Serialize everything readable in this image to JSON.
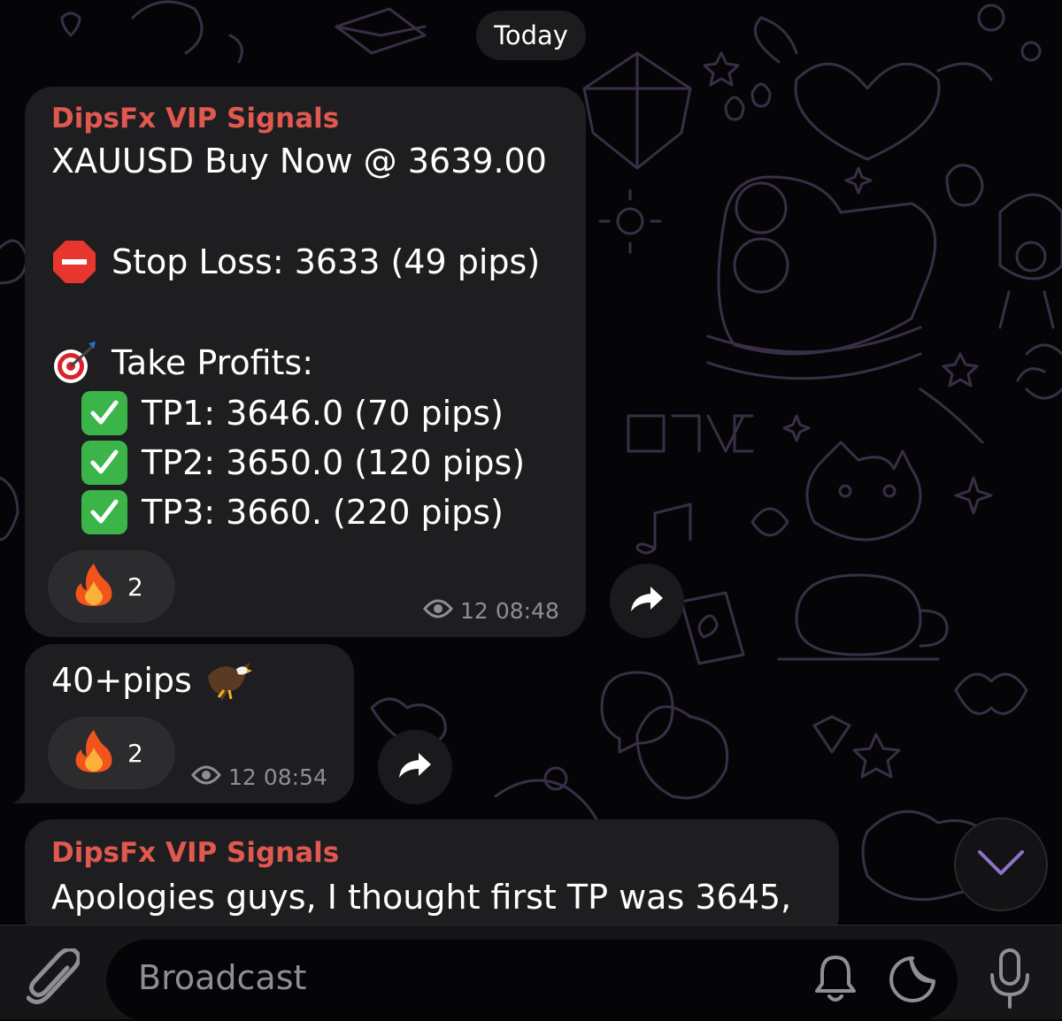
{
  "date_separator": "Today",
  "messages": [
    {
      "sender": "DipsFx VIP Signals",
      "headline": "XAUUSD Buy Now @ 3639.00",
      "stop_loss": "Stop Loss: 3633 (49 pips)",
      "take_profits_label": "Take Profits:",
      "take_profits": [
        "TP1: 3646.0 (70 pips)",
        "TP2: 3650.0 (120 pips)",
        "TP3: 3660. (220 pips)"
      ],
      "reaction": {
        "icon": "fire-icon",
        "count": "2"
      },
      "views": "12",
      "time": "08:48"
    },
    {
      "text": "40+pips",
      "reaction": {
        "icon": "fire-icon",
        "count": "2"
      },
      "views": "12",
      "time": "08:54"
    },
    {
      "sender": "DipsFx VIP Signals",
      "text": "Apologies guys, I thought first TP was 3645,"
    }
  ],
  "composer": {
    "placeholder": "Broadcast"
  },
  "colors": {
    "sender": "#e0584f",
    "bubble": "#1e1e20",
    "background": "#050507",
    "accent_purple": "#8e72c7"
  },
  "icons": [
    "attach-icon",
    "bell-icon",
    "sticker-icon",
    "microphone-icon",
    "forward-icon",
    "eye-icon",
    "chevron-down-icon"
  ]
}
